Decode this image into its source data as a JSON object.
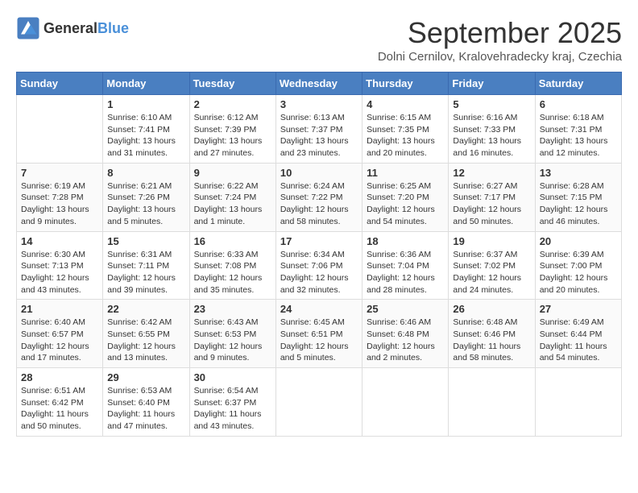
{
  "logo": {
    "general": "General",
    "blue": "Blue"
  },
  "title": "September 2025",
  "location": "Dolni Cernilov, Kralovehradecky kraj, Czechia",
  "headers": [
    "Sunday",
    "Monday",
    "Tuesday",
    "Wednesday",
    "Thursday",
    "Friday",
    "Saturday"
  ],
  "weeks": [
    [
      {
        "day": "",
        "info": ""
      },
      {
        "day": "1",
        "info": "Sunrise: 6:10 AM\nSunset: 7:41 PM\nDaylight: 13 hours\nand 31 minutes."
      },
      {
        "day": "2",
        "info": "Sunrise: 6:12 AM\nSunset: 7:39 PM\nDaylight: 13 hours\nand 27 minutes."
      },
      {
        "day": "3",
        "info": "Sunrise: 6:13 AM\nSunset: 7:37 PM\nDaylight: 13 hours\nand 23 minutes."
      },
      {
        "day": "4",
        "info": "Sunrise: 6:15 AM\nSunset: 7:35 PM\nDaylight: 13 hours\nand 20 minutes."
      },
      {
        "day": "5",
        "info": "Sunrise: 6:16 AM\nSunset: 7:33 PM\nDaylight: 13 hours\nand 16 minutes."
      },
      {
        "day": "6",
        "info": "Sunrise: 6:18 AM\nSunset: 7:31 PM\nDaylight: 13 hours\nand 12 minutes."
      }
    ],
    [
      {
        "day": "7",
        "info": "Sunrise: 6:19 AM\nSunset: 7:28 PM\nDaylight: 13 hours\nand 9 minutes."
      },
      {
        "day": "8",
        "info": "Sunrise: 6:21 AM\nSunset: 7:26 PM\nDaylight: 13 hours\nand 5 minutes."
      },
      {
        "day": "9",
        "info": "Sunrise: 6:22 AM\nSunset: 7:24 PM\nDaylight: 13 hours\nand 1 minute."
      },
      {
        "day": "10",
        "info": "Sunrise: 6:24 AM\nSunset: 7:22 PM\nDaylight: 12 hours\nand 58 minutes."
      },
      {
        "day": "11",
        "info": "Sunrise: 6:25 AM\nSunset: 7:20 PM\nDaylight: 12 hours\nand 54 minutes."
      },
      {
        "day": "12",
        "info": "Sunrise: 6:27 AM\nSunset: 7:17 PM\nDaylight: 12 hours\nand 50 minutes."
      },
      {
        "day": "13",
        "info": "Sunrise: 6:28 AM\nSunset: 7:15 PM\nDaylight: 12 hours\nand 46 minutes."
      }
    ],
    [
      {
        "day": "14",
        "info": "Sunrise: 6:30 AM\nSunset: 7:13 PM\nDaylight: 12 hours\nand 43 minutes."
      },
      {
        "day": "15",
        "info": "Sunrise: 6:31 AM\nSunset: 7:11 PM\nDaylight: 12 hours\nand 39 minutes."
      },
      {
        "day": "16",
        "info": "Sunrise: 6:33 AM\nSunset: 7:08 PM\nDaylight: 12 hours\nand 35 minutes."
      },
      {
        "day": "17",
        "info": "Sunrise: 6:34 AM\nSunset: 7:06 PM\nDaylight: 12 hours\nand 32 minutes."
      },
      {
        "day": "18",
        "info": "Sunrise: 6:36 AM\nSunset: 7:04 PM\nDaylight: 12 hours\nand 28 minutes."
      },
      {
        "day": "19",
        "info": "Sunrise: 6:37 AM\nSunset: 7:02 PM\nDaylight: 12 hours\nand 24 minutes."
      },
      {
        "day": "20",
        "info": "Sunrise: 6:39 AM\nSunset: 7:00 PM\nDaylight: 12 hours\nand 20 minutes."
      }
    ],
    [
      {
        "day": "21",
        "info": "Sunrise: 6:40 AM\nSunset: 6:57 PM\nDaylight: 12 hours\nand 17 minutes."
      },
      {
        "day": "22",
        "info": "Sunrise: 6:42 AM\nSunset: 6:55 PM\nDaylight: 12 hours\nand 13 minutes."
      },
      {
        "day": "23",
        "info": "Sunrise: 6:43 AM\nSunset: 6:53 PM\nDaylight: 12 hours\nand 9 minutes."
      },
      {
        "day": "24",
        "info": "Sunrise: 6:45 AM\nSunset: 6:51 PM\nDaylight: 12 hours\nand 5 minutes."
      },
      {
        "day": "25",
        "info": "Sunrise: 6:46 AM\nSunset: 6:48 PM\nDaylight: 12 hours\nand 2 minutes."
      },
      {
        "day": "26",
        "info": "Sunrise: 6:48 AM\nSunset: 6:46 PM\nDaylight: 11 hours\nand 58 minutes."
      },
      {
        "day": "27",
        "info": "Sunrise: 6:49 AM\nSunset: 6:44 PM\nDaylight: 11 hours\nand 54 minutes."
      }
    ],
    [
      {
        "day": "28",
        "info": "Sunrise: 6:51 AM\nSunset: 6:42 PM\nDaylight: 11 hours\nand 50 minutes."
      },
      {
        "day": "29",
        "info": "Sunrise: 6:53 AM\nSunset: 6:40 PM\nDaylight: 11 hours\nand 47 minutes."
      },
      {
        "day": "30",
        "info": "Sunrise: 6:54 AM\nSunset: 6:37 PM\nDaylight: 11 hours\nand 43 minutes."
      },
      {
        "day": "",
        "info": ""
      },
      {
        "day": "",
        "info": ""
      },
      {
        "day": "",
        "info": ""
      },
      {
        "day": "",
        "info": ""
      }
    ]
  ]
}
